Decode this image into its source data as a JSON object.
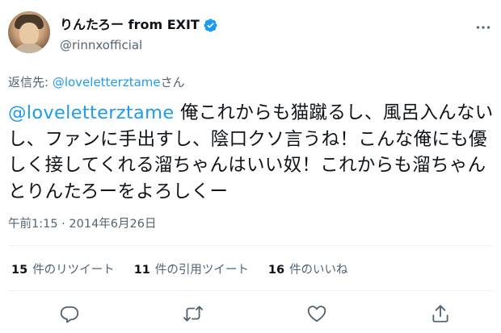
{
  "author": {
    "display_name": "りんたろー from EXIT",
    "handle": "@rinnxofficial"
  },
  "reply_to": {
    "prefix": "返信先: ",
    "mention": "@loveletterztame",
    "suffix": "さん"
  },
  "tweet": {
    "mention": "@loveletterztame",
    "body": " 俺これからも猫蹴るし、風呂入んないし、ファンに手出すし、陰口クソ言うね！こんな俺にも優しく接してくれる溜ちゃんはいい奴！これからも溜ちゃんとりんたろーをよろしくー",
    "timestamp": "午前1:15 · 2014年6月26日"
  },
  "stats": {
    "retweets": {
      "count": "15",
      "label": "件のリツイート"
    },
    "quotes": {
      "count": "11",
      "label": "件の引用ツイート"
    },
    "likes": {
      "count": "16",
      "label": "件のいいね"
    }
  },
  "icons": {
    "verified": "verified-badge-icon",
    "more": "more-icon",
    "reply": "reply-icon",
    "retweet": "retweet-icon",
    "like": "heart-icon",
    "share": "share-icon"
  },
  "colors": {
    "accent": "#1d9bf0",
    "text": "#0f1419",
    "secondary": "#536471",
    "divider": "#eff3f4"
  }
}
